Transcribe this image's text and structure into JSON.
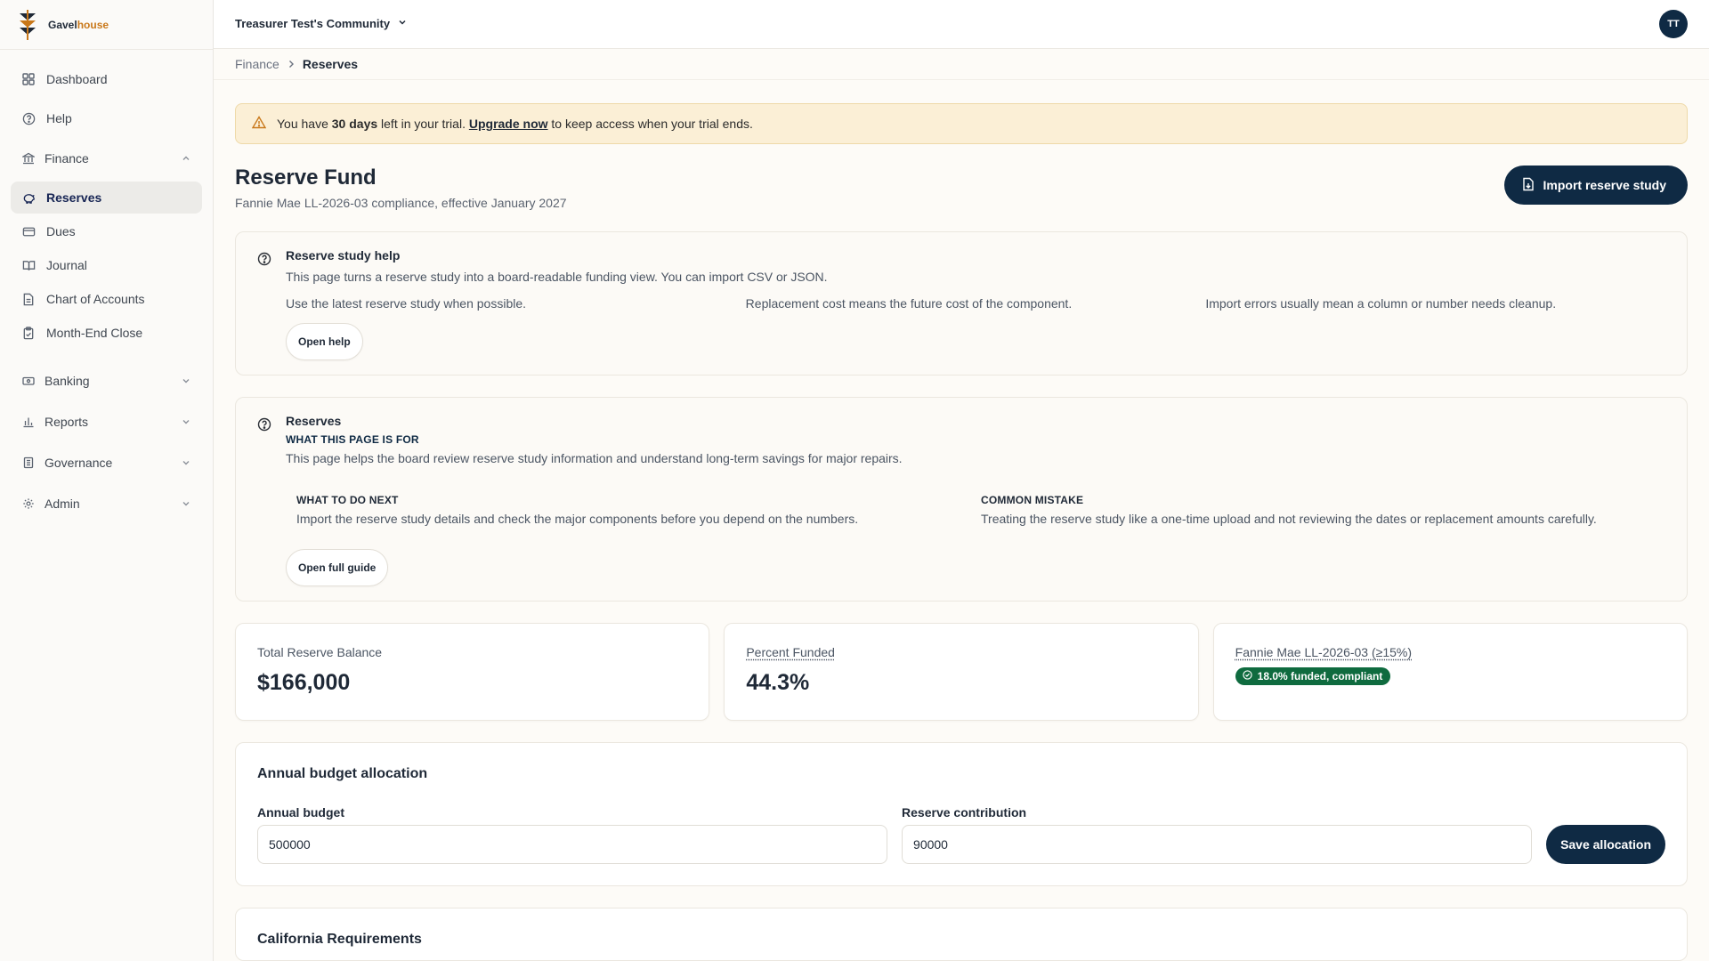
{
  "brand": {
    "name_part1": "Gavel",
    "name_part2": "house",
    "accent_color": "#c9781a"
  },
  "sidebar": {
    "items": [
      {
        "label": "Dashboard"
      },
      {
        "label": "Help"
      }
    ],
    "finance": {
      "label": "Finance",
      "children": [
        {
          "label": "Reserves"
        },
        {
          "label": "Dues"
        },
        {
          "label": "Journal"
        },
        {
          "label": "Chart of Accounts"
        },
        {
          "label": "Month-End Close"
        }
      ]
    },
    "groups": [
      {
        "label": "Banking"
      },
      {
        "label": "Reports"
      },
      {
        "label": "Governance"
      },
      {
        "label": "Admin"
      }
    ]
  },
  "topbar": {
    "community": "Treasurer Test's Community",
    "avatar_initials": "TT"
  },
  "breadcrumb": {
    "parent": "Finance",
    "current": "Reserves"
  },
  "trial": {
    "prefix": "You have",
    "days": "30 days",
    "middle": "left in your trial.",
    "link": "Upgrade now",
    "suffix": "to keep access when your trial ends."
  },
  "page": {
    "title": "Reserve Fund",
    "subtitle": "Fannie Mae LL-2026-03 compliance, effective January 2027",
    "import_button": "Import reserve study"
  },
  "study_help": {
    "title": "Reserve study help",
    "text": "This page turns a reserve study into a board-readable funding view. You can import CSV or JSON.",
    "tips": [
      "Use the latest reserve study when possible.",
      "Replacement cost means the future cost of the component.",
      "Import errors usually mean a column or number needs cleanup."
    ],
    "button": "Open help"
  },
  "reserves_guide": {
    "title": "Reserves",
    "kicker": "WHAT THIS PAGE IS FOR",
    "text": "This page helps the board review reserve study information and understand long-term savings for major repairs.",
    "next_kicker": "WHAT TO DO NEXT",
    "next_text": "Import the reserve study details and check the major components before you depend on the numbers.",
    "mistake_kicker": "COMMON MISTAKE",
    "mistake_text": "Treating the reserve study like a one-time upload and not reviewing the dates or replacement amounts carefully.",
    "button": "Open full guide"
  },
  "stats": {
    "balance_label": "Total Reserve Balance",
    "balance_value": "$166,000",
    "funded_label": "Percent Funded",
    "funded_value": "44.3%",
    "compliance_label": "Fannie Mae LL-2026-03 (≥15%)",
    "compliance_badge": "18.0% funded, compliant"
  },
  "allocation": {
    "title": "Annual budget allocation",
    "budget_label": "Annual budget",
    "budget_value": "500000",
    "contribution_label": "Reserve contribution",
    "contribution_value": "90000",
    "save_button": "Save allocation"
  },
  "california": {
    "title": "California Requirements"
  },
  "colors": {
    "primary": "#0f2a44",
    "success": "#0f6b3f",
    "warning_bg": "#fbefd6"
  }
}
